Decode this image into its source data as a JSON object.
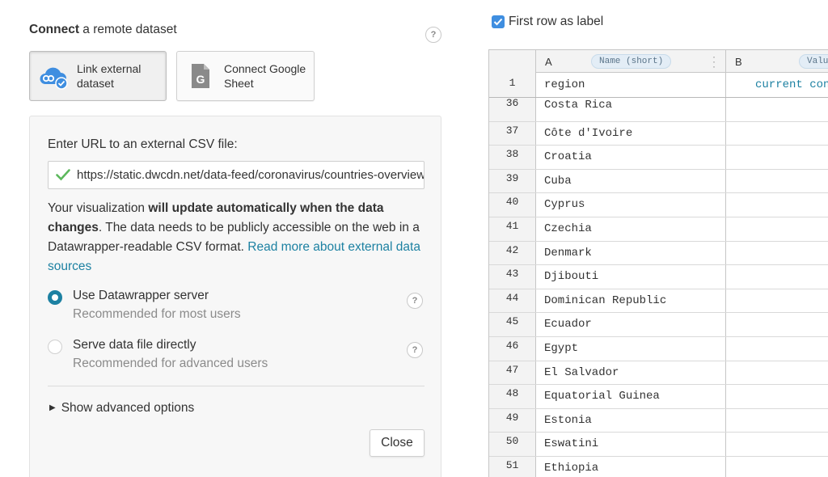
{
  "left_panel": {
    "heading_bold": "Connect",
    "heading_rest": " a remote dataset",
    "help": "?",
    "buttons": [
      {
        "label_line1": "Link external",
        "label_line2": "dataset",
        "icon": "cloud-link-icon",
        "active": true
      },
      {
        "label_line1": "Connect Google",
        "label_line2": "Sheet",
        "icon": "google-sheet-icon",
        "active": false
      }
    ],
    "url_label": "Enter URL to an external CSV file:",
    "url_value": "https://static.dwcdn.net/data-feed/coronavirus/countries-overview.csv",
    "description": {
      "part1": "Your visualization ",
      "bold": "will update automatically when the data changes",
      "part2": ". The data needs to be publicly accessible on the web in a Datawrapper-readable CSV format. ",
      "link": "Read more about external data sources"
    },
    "options": [
      {
        "title": "Use Datawrapper server",
        "subtitle": "Recommended for most users",
        "selected": true
      },
      {
        "title": "Serve data file directly",
        "subtitle": "Recommended for advanced users",
        "selected": false
      }
    ],
    "advanced_label": "Show advanced options",
    "close_label": "Close",
    "accent_color": "#1d81a2"
  },
  "right_panel": {
    "checkbox_label": "First row as label",
    "checkbox_checked": true,
    "columns": [
      {
        "letter": "A",
        "name": "Name (short)"
      },
      {
        "letter": "B",
        "name": "Value"
      }
    ],
    "header_row": {
      "num": "1",
      "a": "region",
      "b": "current confirmed"
    },
    "rows": [
      {
        "num": "36",
        "a": "Costa Rica"
      },
      {
        "num": "37",
        "a": "Côte d'Ivoire"
      },
      {
        "num": "38",
        "a": "Croatia"
      },
      {
        "num": "39",
        "a": "Cuba"
      },
      {
        "num": "40",
        "a": "Cyprus"
      },
      {
        "num": "41",
        "a": "Czechia"
      },
      {
        "num": "42",
        "a": "Denmark"
      },
      {
        "num": "43",
        "a": "Djibouti"
      },
      {
        "num": "44",
        "a": "Dominican Republic"
      },
      {
        "num": "45",
        "a": "Ecuador"
      },
      {
        "num": "46",
        "a": "Egypt"
      },
      {
        "num": "47",
        "a": "El Salvador"
      },
      {
        "num": "48",
        "a": "Equatorial Guinea"
      },
      {
        "num": "49",
        "a": "Estonia"
      },
      {
        "num": "50",
        "a": "Eswatini"
      },
      {
        "num": "51",
        "a": "Ethiopia"
      }
    ]
  }
}
